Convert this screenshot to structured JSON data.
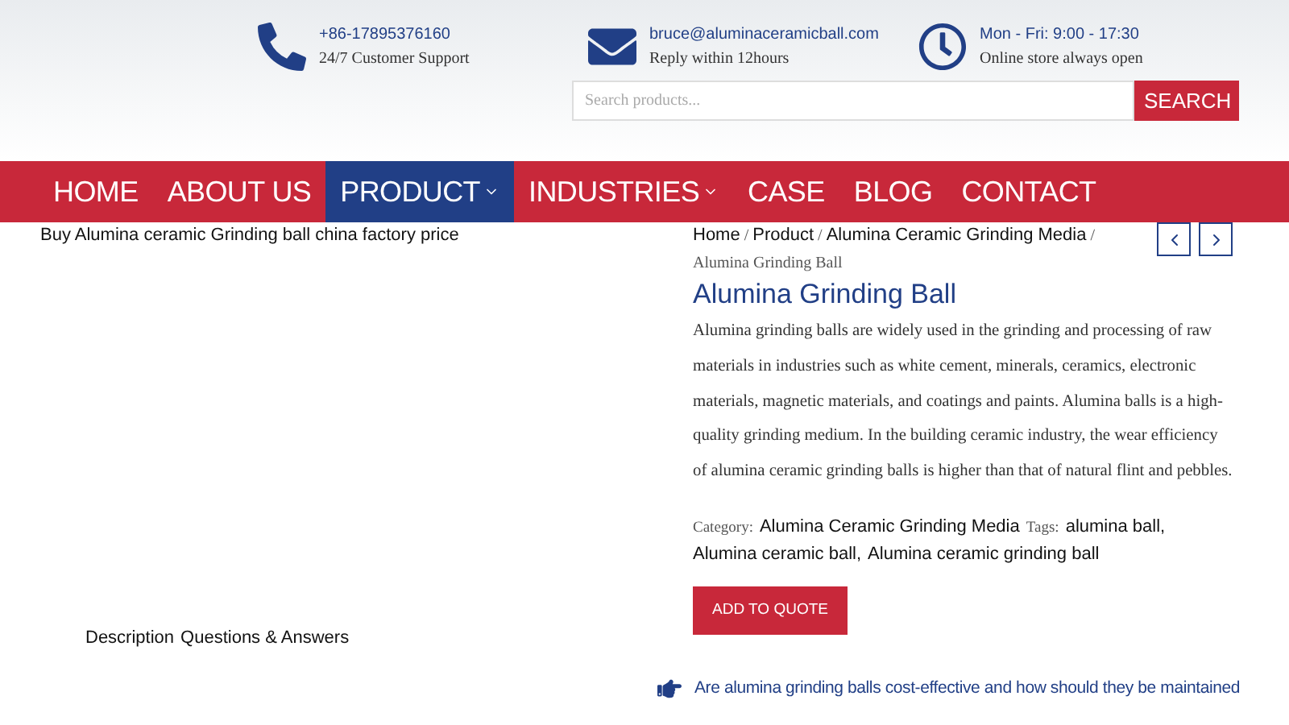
{
  "contacts": [
    {
      "kind": "phone",
      "title": "+86-17895376160",
      "subtitle": "24/7 Customer Support"
    },
    {
      "kind": "mail",
      "title": "bruce@aluminaceramicball.com",
      "subtitle": "Reply within 12hours"
    },
    {
      "kind": "clock",
      "title": "Mon - Fri: 9:00 - 17:30",
      "subtitle": "Online store always open"
    }
  ],
  "search": {
    "placeholder": "Search products...",
    "button": "SEARCH"
  },
  "nav": [
    {
      "label": "HOME",
      "selected": false,
      "dropdown": false
    },
    {
      "label": "ABOUT US",
      "selected": false,
      "dropdown": false
    },
    {
      "label": "PRODUCT",
      "selected": true,
      "dropdown": true
    },
    {
      "label": "INDUSTRIES",
      "selected": false,
      "dropdown": true
    },
    {
      "label": "CASE",
      "selected": false,
      "dropdown": false
    },
    {
      "label": "BLOG",
      "selected": false,
      "dropdown": false
    },
    {
      "label": "CONTACT",
      "selected": false,
      "dropdown": false
    }
  ],
  "image_caption": "Buy Alumina ceramic Grinding ball china factory price",
  "tabs": [
    "Description",
    "Questions & Answers"
  ],
  "breadcrumb": {
    "separator": "/",
    "links": [
      "Home",
      "Product",
      "Alumina Ceramic Grinding Media"
    ],
    "current": "Alumina Grinding Ball"
  },
  "product": {
    "title": "Alumina Grinding Ball",
    "description": "Alumina grinding balls are widely used in the grinding and processing of raw materials in industries such as white cement, minerals, ceramics, electronic materials, magnetic materials, and coatings and paints. Alumina balls is a high-quality grinding medium. In the building ceramic industry, the wear efficiency of alumina ceramic grinding balls is higher than that of natural flint and pebbles.",
    "category_label": "Category:",
    "categories": [
      "Alumina Ceramic Grinding Media"
    ],
    "tags_label": "Tags:",
    "tags": [
      "alumina ball,",
      "Alumina ceramic ball,",
      "Alumina ceramic grinding ball"
    ],
    "button": "ADD TO QUOTE"
  },
  "faq": [
    "Are alumina grinding balls cost-effective and how should they be maintained"
  ]
}
